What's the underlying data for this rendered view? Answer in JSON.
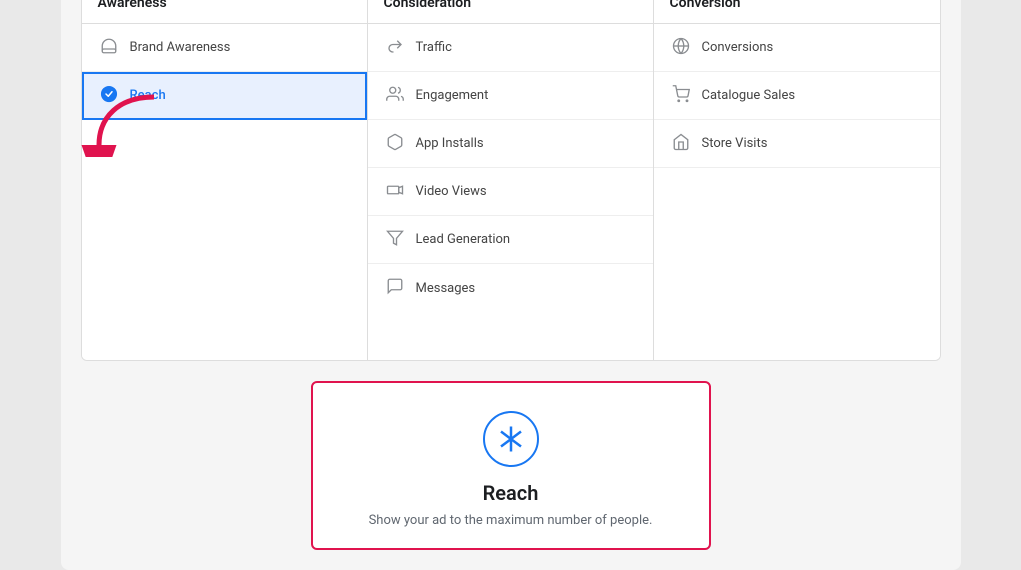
{
  "headers": {
    "col1": "Awareness",
    "col2": "Consideration",
    "col3": "Conversion"
  },
  "col1_items": [
    {
      "id": "brand-awareness",
      "label": "Brand Awareness",
      "icon": "flag",
      "selected": false
    },
    {
      "id": "reach",
      "label": "Reach",
      "icon": "check-circle",
      "selected": true
    }
  ],
  "col2_items": [
    {
      "id": "traffic",
      "label": "Traffic",
      "icon": "cursor",
      "selected": false
    },
    {
      "id": "engagement",
      "label": "Engagement",
      "icon": "people",
      "selected": false
    },
    {
      "id": "app-installs",
      "label": "App Installs",
      "icon": "box",
      "selected": false
    },
    {
      "id": "video-views",
      "label": "Video Views",
      "icon": "video",
      "selected": false
    },
    {
      "id": "lead-generation",
      "label": "Lead Generation",
      "icon": "filter",
      "selected": false
    },
    {
      "id": "messages",
      "label": "Messages",
      "icon": "chat",
      "selected": false
    }
  ],
  "col3_items": [
    {
      "id": "conversions",
      "label": "Conversions",
      "icon": "globe",
      "selected": false
    },
    {
      "id": "catalogue-sales",
      "label": "Catalogue Sales",
      "icon": "cart",
      "selected": false
    },
    {
      "id": "store-visits",
      "label": "Store Visits",
      "icon": "store",
      "selected": false
    }
  ],
  "info_box": {
    "title": "Reach",
    "description": "Show your ad to the maximum number of people.",
    "icon_label": "reach-asterisk-icon"
  }
}
